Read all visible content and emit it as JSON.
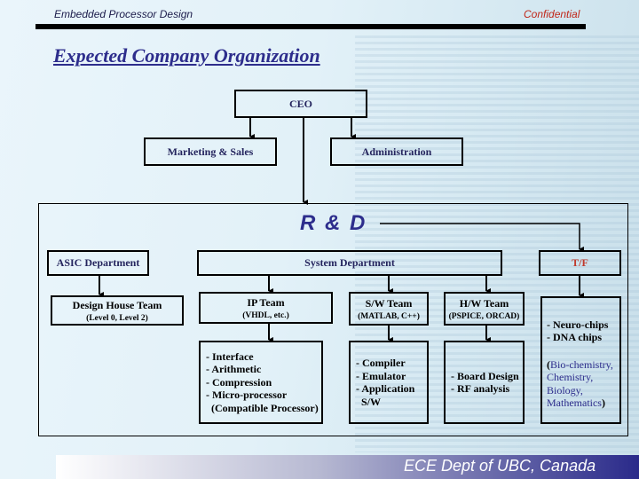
{
  "header": {
    "course": "Embedded Processor Design",
    "classification": "Confidential"
  },
  "title": "Expected Company Organization",
  "org": {
    "ceo": "CEO",
    "marketing": "Marketing & Sales",
    "administration": "Administration",
    "rnd": "R & D",
    "asic": {
      "label": "ASIC Department",
      "team": "Design House Team",
      "team_sub": "(Level 0, Level 2)"
    },
    "system": {
      "label": "System Department",
      "ip": {
        "label": "IP Team",
        "sub": "(VHDL, etc.)",
        "items": [
          "- Interface",
          "- Arithmetic",
          "- Compression",
          "- Micro-processor",
          "  (Compatible Processor)"
        ]
      },
      "sw": {
        "label": "S/W Team",
        "sub": "(MATLAB, C++)",
        "items": [
          "- Compiler",
          "- Emulator",
          "- Application",
          "  S/W"
        ]
      },
      "hw": {
        "label": "H/W Team",
        "sub": "(PSPICE, ORCAD)",
        "items": [
          "- Board Design",
          "- RF analysis"
        ]
      }
    },
    "tf": {
      "label": "T/F",
      "items": [
        "- Neuro-chips",
        "- DNA chips"
      ],
      "fields_open": "(",
      "fields": [
        "Bio-chemistry,",
        "Chemistry,",
        "Biology,",
        "Mathematics"
      ],
      "fields_close": ")"
    }
  },
  "footer": "ECE Dept of UBC, Canada",
  "colors": {
    "title": "#2d2d8c",
    "confidential": "#c0281a",
    "tf": "#c0392b",
    "footer_dark": "#2a2a8a"
  }
}
